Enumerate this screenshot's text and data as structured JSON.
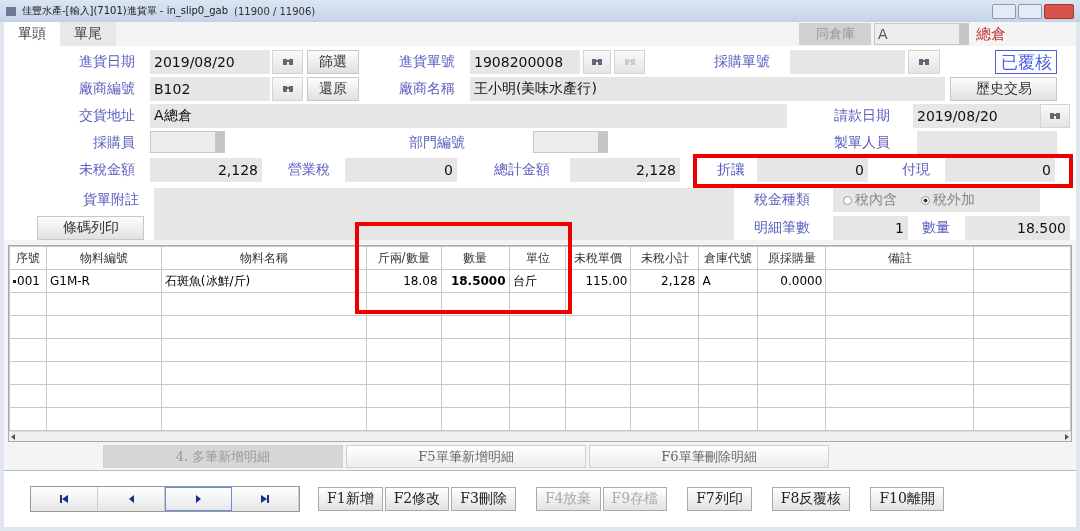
{
  "window": {
    "title": "佳豐水產-[輸入](7101)進貨單 - in_slip0_gab",
    "counter": "(11900 / 11906)"
  },
  "tabs": [
    {
      "label": "單頭",
      "selected": true
    },
    {
      "label": "單尾",
      "selected": false
    }
  ],
  "warehouse": {
    "button": "同倉庫",
    "value": "A",
    "name": "總倉"
  },
  "header_rows": [
    [
      {
        "kind": "label",
        "text": "進貨日期"
      },
      {
        "kind": "field",
        "value": "2019/08/20"
      },
      {
        "kind": "lookup",
        "disabled": false
      },
      {
        "kind": "button",
        "label": "篩選"
      },
      {
        "kind": "label",
        "text": "進貨單號"
      },
      {
        "kind": "field",
        "value": "1908200008"
      },
      {
        "kind": "lookup",
        "disabled": false
      },
      {
        "kind": "lookup",
        "disabled": true
      },
      {
        "kind": "label",
        "text": "採購單號"
      },
      {
        "kind": "field"
      },
      {
        "kind": "lookup",
        "disabled": false
      },
      {
        "kind": "stamp",
        "text": "已覆核"
      }
    ],
    [
      {
        "kind": "label",
        "text": "廠商編號"
      },
      {
        "kind": "field",
        "value": "B102"
      },
      {
        "kind": "lookup",
        "disabled": false
      },
      {
        "kind": "button",
        "label": "還原"
      },
      {
        "kind": "label",
        "text": "廠商名稱"
      },
      {
        "kind": "field",
        "value": "王小明(美味水產行)"
      },
      {
        "kind": "button",
        "label": "歷史交易"
      }
    ],
    [
      {
        "kind": "label",
        "text": "交貨地址"
      },
      {
        "kind": "field",
        "value": "A總倉"
      },
      {
        "kind": "label",
        "text": "請款日期"
      },
      {
        "kind": "field",
        "value": "2019/08/20"
      },
      {
        "kind": "lookup",
        "disabled": false
      }
    ],
    [
      {
        "kind": "label",
        "text": "採購員"
      },
      {
        "kind": "combo"
      },
      {
        "kind": "label",
        "text": "部門編號"
      },
      {
        "kind": "combo"
      },
      {
        "kind": "label",
        "text": "製單人員"
      },
      {
        "kind": "field"
      }
    ],
    [
      {
        "kind": "label",
        "text": "未稅金額"
      },
      {
        "kind": "number",
        "value": "2,128"
      },
      {
        "kind": "label",
        "text": "營業稅"
      },
      {
        "kind": "number",
        "value": "0"
      },
      {
        "kind": "label",
        "text": "總計金額"
      },
      {
        "kind": "number",
        "value": "2,128"
      },
      {
        "kind": "label",
        "text": "折讓"
      },
      {
        "kind": "number",
        "value": "0"
      },
      {
        "kind": "label",
        "text": "付現"
      },
      {
        "kind": "number",
        "value": "0"
      }
    ]
  ],
  "notes_block": {
    "label": "貨單附註",
    "barcode_button": "條碼列印",
    "right_rows": [
      [
        {
          "kind": "label",
          "text": "稅金種類"
        },
        {
          "kind": "radios",
          "options": [
            {
              "label": "稅內含",
              "selected": false
            },
            {
              "label": "稅外加",
              "selected": true
            }
          ]
        }
      ],
      [
        {
          "kind": "label",
          "text": "明細筆數"
        },
        {
          "kind": "number",
          "value": "1"
        },
        {
          "kind": "label",
          "text": "數量"
        },
        {
          "kind": "number",
          "value": "18.500"
        }
      ]
    ]
  },
  "table": {
    "columns": [
      "序號",
      "物料編號",
      "物料名稱",
      "斤兩/數量",
      "數量",
      "單位",
      "未稅單價",
      "未稅小計",
      "倉庫代號",
      "原採購量",
      "備註"
    ],
    "rows": [
      {
        "current": true,
        "cells": [
          "001",
          "G1M-R",
          "石斑魚(冰鮮/斤)",
          "18.08",
          "18.5000",
          "台斤",
          "115.00",
          "2,128",
          "A",
          "0.0000"
        ]
      }
    ]
  },
  "detail_buttons": [
    {
      "label": "4. 多筆新增明細",
      "disabled": true
    },
    {
      "label": "F5單筆新增明細",
      "disabled": false
    },
    {
      "label": "F6單筆刪除明細",
      "disabled": false
    }
  ],
  "navigation": [
    {
      "kind": "first",
      "selected": false
    },
    {
      "kind": "previous",
      "selected": false
    },
    {
      "kind": "next",
      "selected": true
    },
    {
      "kind": "last",
      "selected": false
    }
  ],
  "function_buttons": [
    {
      "label": "F1新增",
      "disabled": false
    },
    {
      "label": "F2修改",
      "disabled": false
    },
    {
      "label": "F3刪除",
      "disabled": false
    },
    {
      "label": "F4放棄",
      "disabled": true
    },
    {
      "label": "F9存檔",
      "disabled": true
    },
    {
      "label": "F7列印",
      "disabled": false
    },
    {
      "label": "F8反覆核",
      "disabled": false
    },
    {
      "label": "F10離開",
      "disabled": false
    }
  ]
}
